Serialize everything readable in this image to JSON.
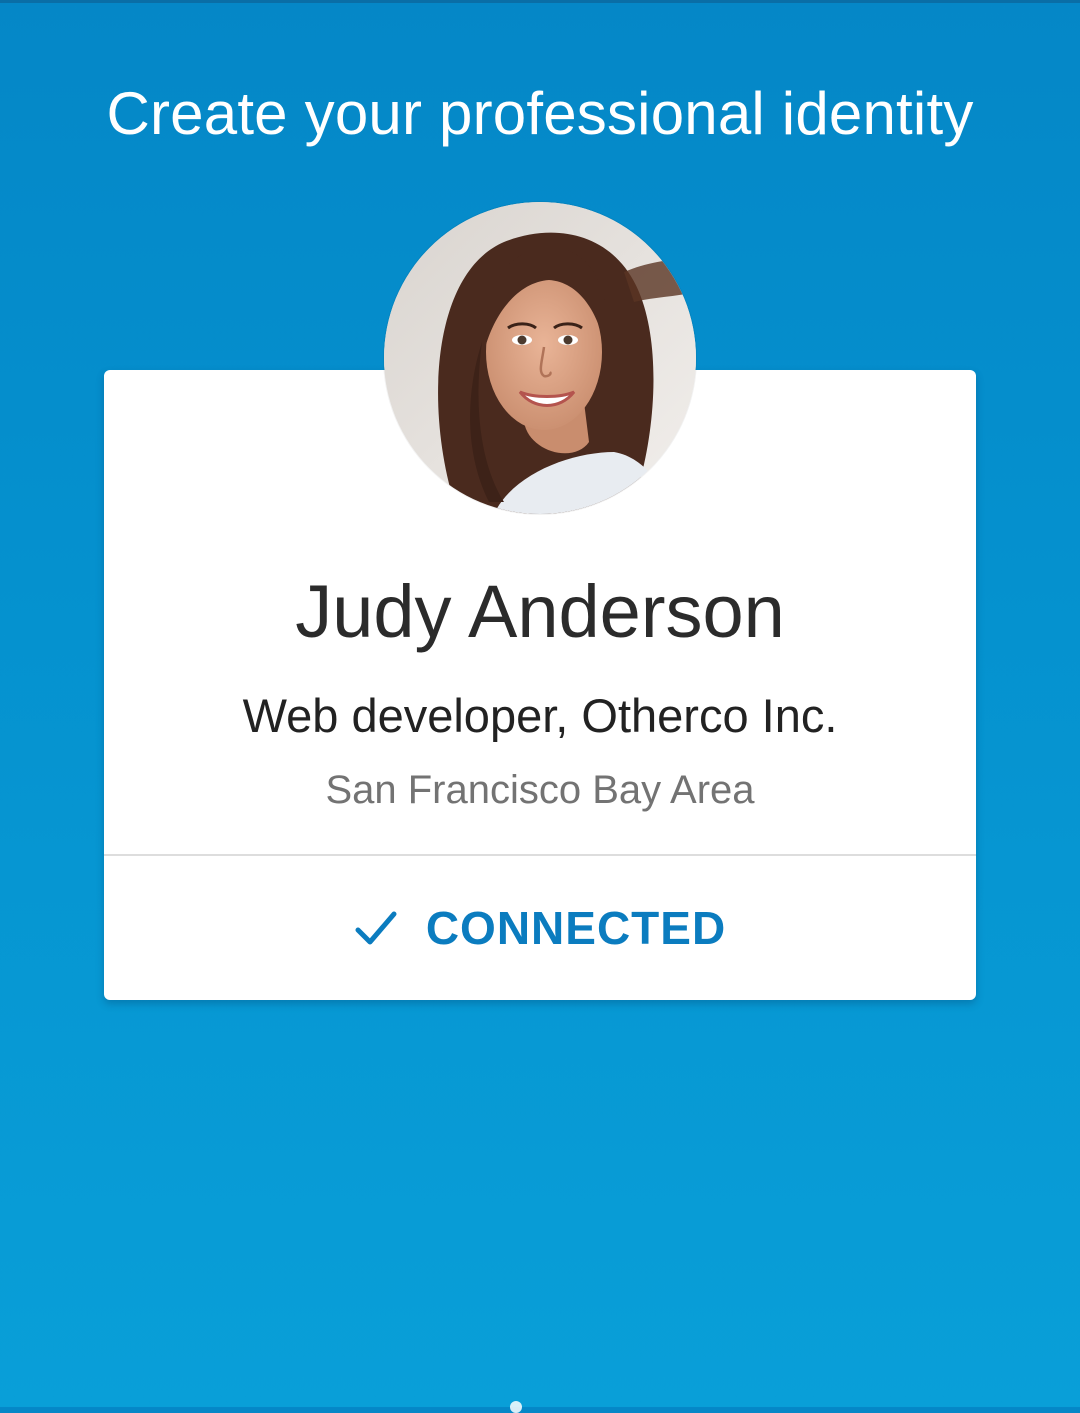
{
  "screen": {
    "headline": "Create your professional identity"
  },
  "profile_card": {
    "name": "Judy Anderson",
    "headline": "Web developer, Otherco Inc.",
    "location": "San Francisco Bay Area",
    "status_label": "CONNECTED",
    "status_icon": "checkmark-icon",
    "avatar_icon": "profile-photo"
  },
  "colors": {
    "background_top": "#0587c7",
    "background_bottom": "#099fd8",
    "accent": "#0b7cbf",
    "card": "#ffffff"
  }
}
